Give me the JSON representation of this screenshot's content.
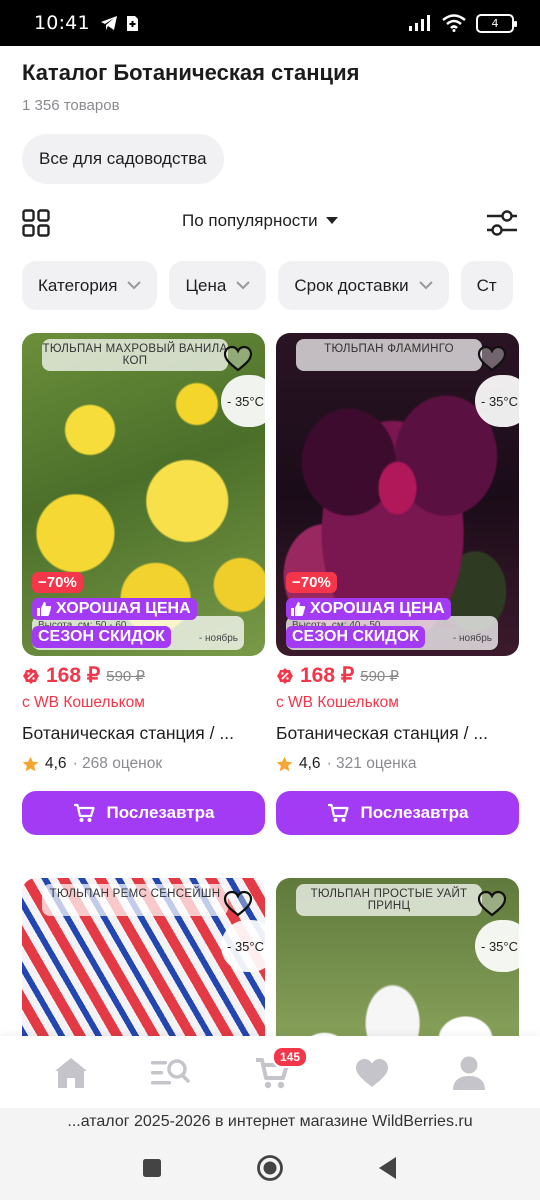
{
  "status_bar": {
    "time": "10:41",
    "battery": "4"
  },
  "header": {
    "title": "Каталог Ботаническая станция",
    "count": "1 356 товаров",
    "category_chip": "Все для садоводства"
  },
  "toolbar": {
    "sort_label": "По популярности"
  },
  "filters": [
    "Категория",
    "Цена",
    "Срок доставки",
    "Ст"
  ],
  "products": [
    {
      "image_label": "ТЮЛЬПАН МАХРОВЫЙ ВАНИЛА КОП",
      "temp": "- 35°C",
      "discount": "−70%",
      "good_price": "ХОРОШАЯ ЦЕНА",
      "sale": "СЕЗОН СКИДОК",
      "info_strip": "Высота, см: 50 - 60",
      "info_tail": "- ноябрь",
      "price": "168 ₽",
      "old_price": "590 ₽",
      "wallet": "с WB Кошельком",
      "brand": "Ботаническая станция / ...",
      "rating": "4,6",
      "reviews": "· 268 оценок",
      "button": "Послезавтра"
    },
    {
      "image_label": "ТЮЛЬПАН ФЛАМИНГО",
      "temp": "- 35°C",
      "discount": "−70%",
      "good_price": "ХОРОШАЯ ЦЕНА",
      "sale": "СЕЗОН СКИДОК",
      "info_strip": "Высота, см: 40 - 50",
      "info_tail": "- ноябрь",
      "price": "168 ₽",
      "old_price": "590 ₽",
      "wallet": "с WB Кошельком",
      "brand": "Ботаническая станция / ...",
      "rating": "4,6",
      "reviews": "· 321 оценка",
      "button": "Послезавтра"
    },
    {
      "image_label": "ТЮЛЬПАН РЕМС СЕНСЕЙШН",
      "temp": "- 35°C"
    },
    {
      "image_label": "ТЮЛЬПАН ПРОСТЫЕ УАЙТ ПРИНЦ",
      "temp": "- 35°C"
    }
  ],
  "bottom_nav": {
    "cart_badge": "145"
  },
  "url_bar": "...аталог 2025-2026 в интернет магазине WildBerries.ru",
  "colors": {
    "accent": "#a33bf5",
    "price": "#f3364a",
    "chip_bg": "#f1f1f4"
  },
  "icons": [
    "telegram-icon",
    "sim-icon",
    "signal-icon",
    "wifi-icon",
    "battery-icon",
    "grid-view-icon",
    "sort-chevron-icon",
    "filter-sliders-icon",
    "heart-icon",
    "thumbs-up-icon",
    "wallet-price-icon",
    "star-icon",
    "cart-icon",
    "home-icon",
    "catalog-search-icon",
    "profile-icon"
  ]
}
